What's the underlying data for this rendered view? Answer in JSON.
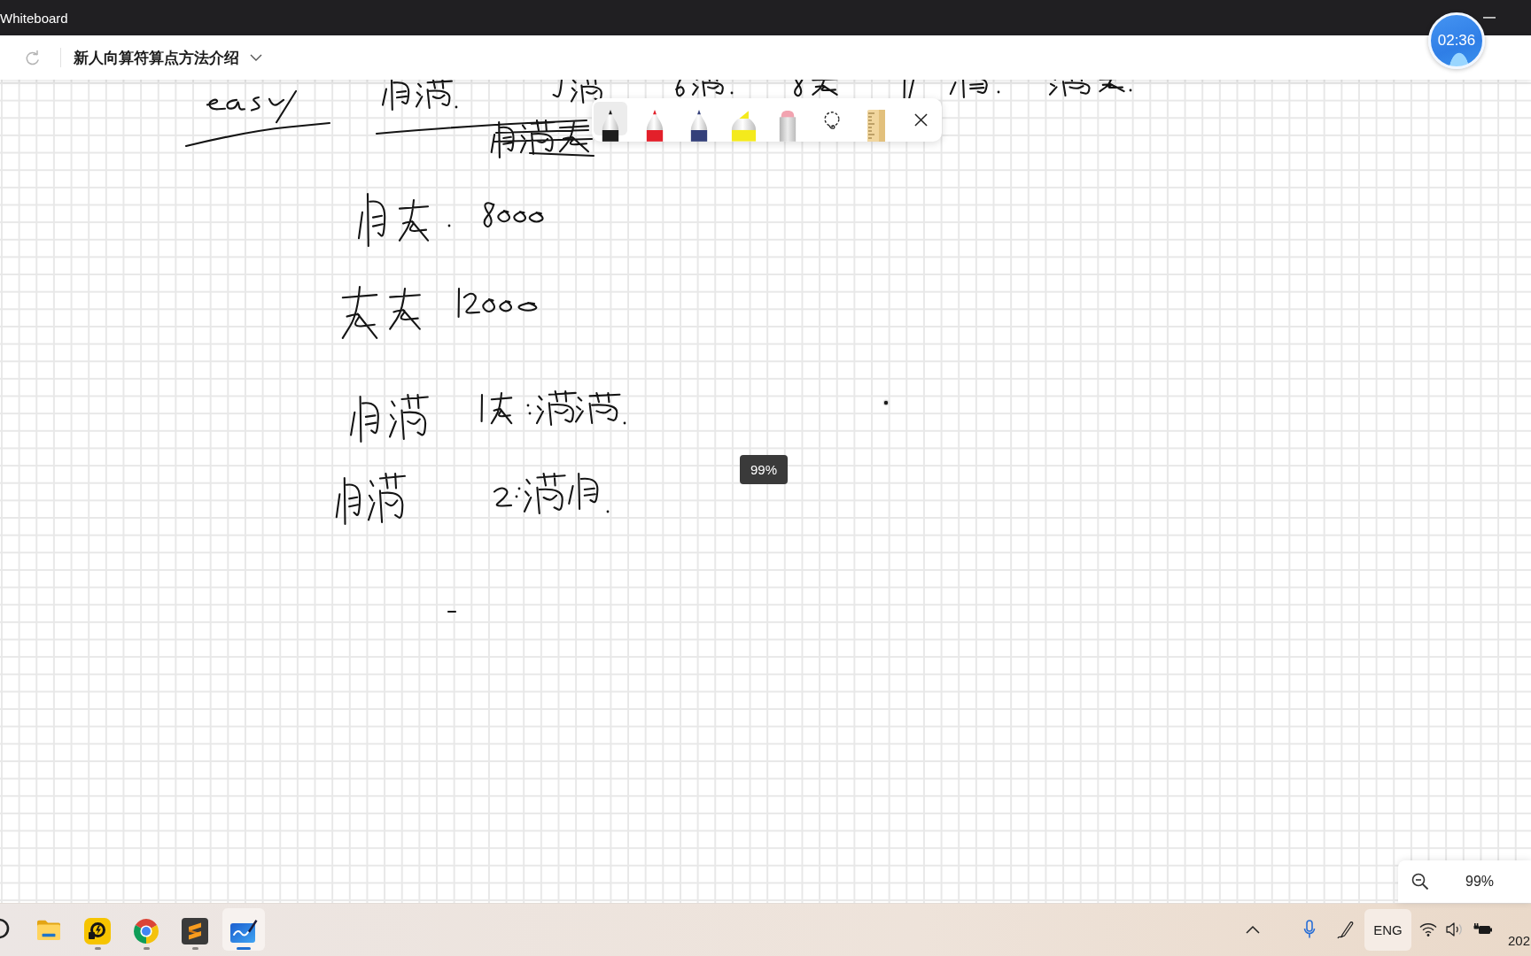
{
  "window": {
    "title": "Whiteboard"
  },
  "header": {
    "redo": {
      "disabled": true
    },
    "title": "新人向算符算点方法介绍"
  },
  "timer": {
    "time": "02:36"
  },
  "pen_toolbar": {
    "tools": [
      {
        "kind": "pen",
        "selected": true,
        "color": "#1c1c1c"
      },
      {
        "kind": "pen",
        "selected": false,
        "color": "#e3202a"
      },
      {
        "kind": "pen",
        "selected": false,
        "color": "#34407a"
      },
      {
        "kind": "highlighter",
        "selected": false,
        "color": "#f4ea1c"
      },
      {
        "kind": "eraser",
        "selected": false
      },
      {
        "kind": "lasso",
        "selected": false
      },
      {
        "kind": "ruler",
        "selected": false
      }
    ]
  },
  "canvas": {
    "zoom_tooltip": "99%"
  },
  "zoom_control": {
    "zoom": "99%"
  },
  "taskbar": {
    "apps": [
      {
        "kind": "search",
        "running": false,
        "selected": false
      },
      {
        "kind": "files",
        "running": false,
        "selected": false
      },
      {
        "kind": "player",
        "running": true,
        "selected": false
      },
      {
        "kind": "browser",
        "running": true,
        "selected": false
      },
      {
        "kind": "editor",
        "running": true,
        "selected": false
      },
      {
        "kind": "whiteboard",
        "running": true,
        "selected": true
      }
    ],
    "tray": {
      "language": "ENG",
      "clock": "202"
    }
  }
}
